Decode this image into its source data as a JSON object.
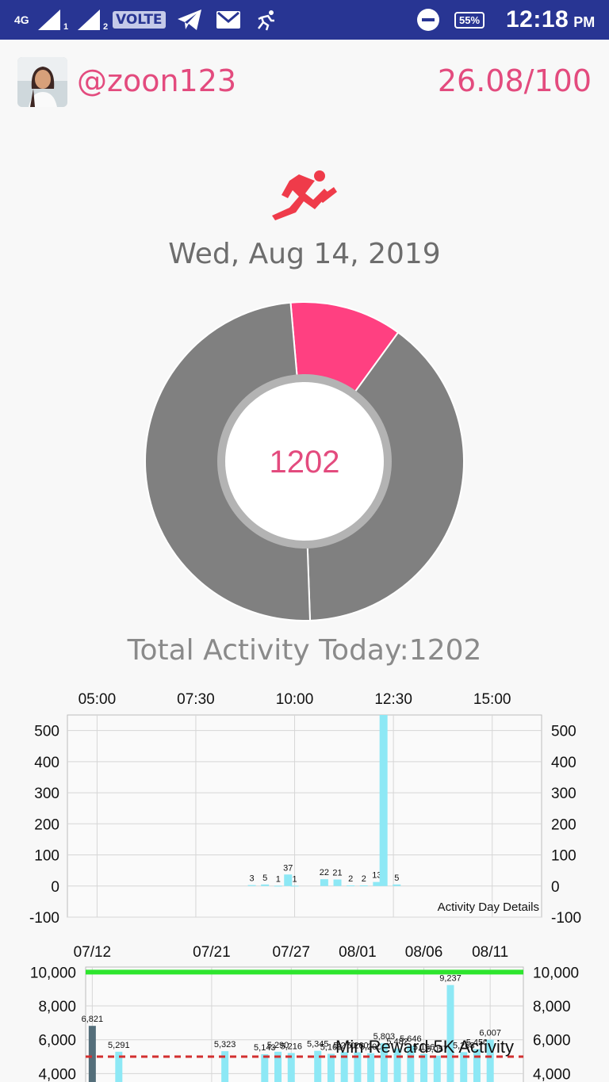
{
  "status_bar": {
    "network": "4G",
    "sim1": "1",
    "sim2": "2",
    "volte": "VOLTE",
    "battery": "55%",
    "time": "12:18",
    "ampm": "PM",
    "icons": [
      "signal-icon",
      "telegram-icon",
      "gmail-icon",
      "runner-notification-icon",
      "dnd-icon",
      "battery-icon"
    ]
  },
  "header": {
    "username": "@zoon123",
    "score": "26.08/100"
  },
  "date": "Wed, Aug 14, 2019",
  "donut": {
    "center_value": "1202",
    "slices": [
      {
        "start_deg": -5,
        "end_deg": 36,
        "color": "#ff4081"
      },
      {
        "start_deg": 36,
        "end_deg": 178,
        "color": "#808080"
      },
      {
        "start_deg": 178,
        "end_deg": 355,
        "color": "#808080"
      }
    ],
    "inner_ring_color": "#b3b3b3"
  },
  "total_activity": "Total Activity Today:1202",
  "chart_data": [
    {
      "type": "bar",
      "description": "Activity Day Details",
      "x_ticks": [
        "05:00",
        "07:30",
        "10:00",
        "12:30",
        "15:00"
      ],
      "x_range": [
        "04:15",
        "16:15"
      ],
      "y_ticks": [
        "500",
        "400",
        "300",
        "200",
        "100",
        "0",
        "-100"
      ],
      "ylim": [
        -100,
        550
      ],
      "series_label": "Activity Day Details",
      "bars": [
        {
          "x": "08:55",
          "value": 3,
          "label": "3"
        },
        {
          "x": "09:15",
          "value": 5,
          "label": "5"
        },
        {
          "x": "09:35",
          "value": 1,
          "label": "1"
        },
        {
          "x": "09:50",
          "value": 37,
          "label": "37"
        },
        {
          "x": "10:00",
          "value": 1,
          "label": "1"
        },
        {
          "x": "10:45",
          "value": 22,
          "label": "22"
        },
        {
          "x": "11:05",
          "value": 21,
          "label": "21"
        },
        {
          "x": "11:25",
          "value": 2,
          "label": "2"
        },
        {
          "x": "11:45",
          "value": 2,
          "label": "2"
        },
        {
          "x": "12:05",
          "value": 13,
          "label": "13"
        },
        {
          "x": "12:15",
          "value": 550,
          "label": ""
        },
        {
          "x": "12:35",
          "value": 5,
          "label": "5"
        }
      ],
      "bar_color": "#8de8f5"
    },
    {
      "type": "bar",
      "description": "Min Reward 5K Activity",
      "x_ticks": [
        "07/12",
        "07/21",
        "07/27",
        "08/01",
        "08/06",
        "08/11"
      ],
      "y_ticks": [
        "10,000",
        "8,000",
        "6,000",
        "4,000"
      ],
      "ylim": [
        3500,
        10300
      ],
      "reference_lines": [
        {
          "label": "",
          "value": 10000,
          "color": "#2ee52e"
        },
        {
          "label": "Min Reward 5K Activity",
          "value": 5000,
          "color": "#d32f2f",
          "style": "dashed"
        }
      ],
      "bar_color": "#8de8f5",
      "highlight_color": "#546e7a",
      "bars": [
        {
          "date": "07/12",
          "value": 6821,
          "label": "6,821",
          "highlight": true
        },
        {
          "date": "07/14",
          "value": 5291,
          "label": "5,291"
        },
        {
          "date": "07/22",
          "value": 5323,
          "label": "5,323"
        },
        {
          "date": "07/25",
          "value": 5143,
          "label": "5,143"
        },
        {
          "date": "07/26",
          "value": 5290,
          "label": "5,290"
        },
        {
          "date": "07/27",
          "value": 5216,
          "label": "5,216"
        },
        {
          "date": "07/29",
          "value": 5345,
          "label": "5,345"
        },
        {
          "date": "07/30",
          "value": 5168,
          "label": "5,168"
        },
        {
          "date": "07/31",
          "value": 5270,
          "label": "5,270"
        },
        {
          "date": "08/01",
          "value": 5260,
          "label": "5,260"
        },
        {
          "date": "08/02",
          "value": 5200,
          "label": "5,200"
        },
        {
          "date": "08/03",
          "value": 5803,
          "label": "5,803"
        },
        {
          "date": "08/04",
          "value": 5482,
          "label": "5,482"
        },
        {
          "date": "08/05",
          "value": 5646,
          "label": "5,646"
        },
        {
          "date": "08/06",
          "value": 5166,
          "label": "5,166"
        },
        {
          "date": "08/07",
          "value": 5057,
          "label": "5,057"
        },
        {
          "date": "08/08",
          "value": 9237,
          "label": "9,237"
        },
        {
          "date": "08/09",
          "value": 5268,
          "label": "5,268"
        },
        {
          "date": "08/10",
          "value": 5450,
          "label": "5,450"
        },
        {
          "date": "08/11",
          "value": 6007,
          "label": "6,007"
        }
      ]
    }
  ]
}
